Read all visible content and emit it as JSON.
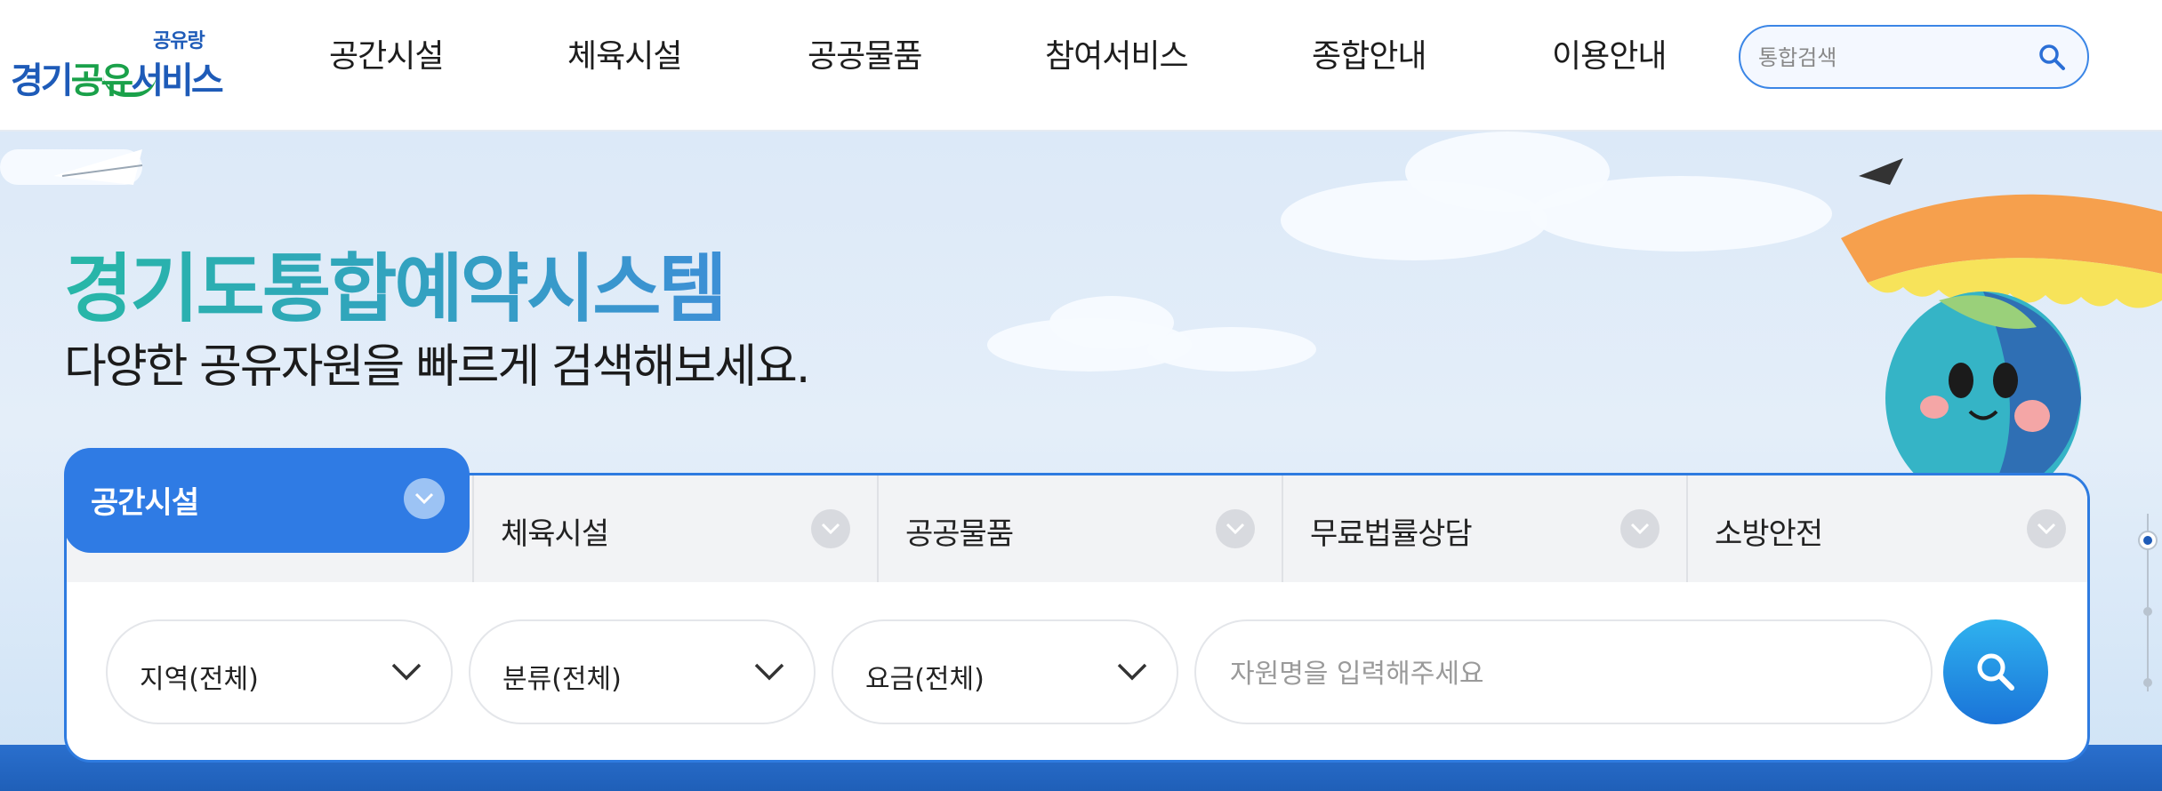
{
  "logo": {
    "main_blue": "경기",
    "main_green": "공유",
    "main_blue2": "서비스",
    "sub": "공유랑"
  },
  "nav": {
    "items": [
      "공간시설",
      "체육시설",
      "공공물품",
      "참여서비스",
      "종합안내",
      "이용안내"
    ]
  },
  "header_search": {
    "placeholder": "통합검색",
    "icon": "search-icon"
  },
  "hero": {
    "title": "경기도통합예약시스템",
    "subtitle": "다양한 공유자원을 빠르게 검색해보세요."
  },
  "category_tabs": {
    "active": "공간시설",
    "items": [
      "체육시설",
      "공공물품",
      "무료법률상담",
      "소방안전"
    ]
  },
  "filters": {
    "region": "지역(전체)",
    "category": "분류(전체)",
    "fee": "요금(전체)"
  },
  "keyword": {
    "placeholder": "자원명을 입력해주세요"
  },
  "colors": {
    "accent": "#2f7be4",
    "brand_green": "#1aa14a",
    "brand_blue": "#1e5bb8"
  }
}
